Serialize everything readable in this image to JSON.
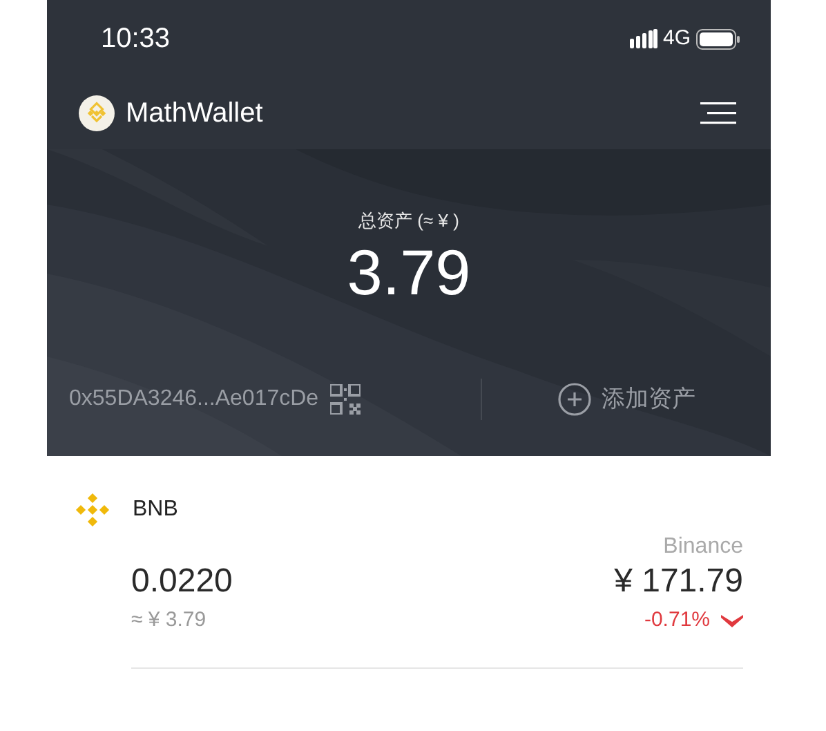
{
  "status_bar": {
    "time": "10:33",
    "network": "4G"
  },
  "header": {
    "title": "MathWallet"
  },
  "summary": {
    "label": "总资产 (≈ ¥ )",
    "total": "3.79",
    "address": "0x55DA3246...Ae017cDe",
    "add_button": "添加资产"
  },
  "assets": [
    {
      "symbol": "BNB",
      "exchange": "Binance",
      "amount": "0.0220",
      "value": "≈ ¥ 3.79",
      "price": "¥ 171.79",
      "change": "-0.71%",
      "falling": true
    }
  ]
}
